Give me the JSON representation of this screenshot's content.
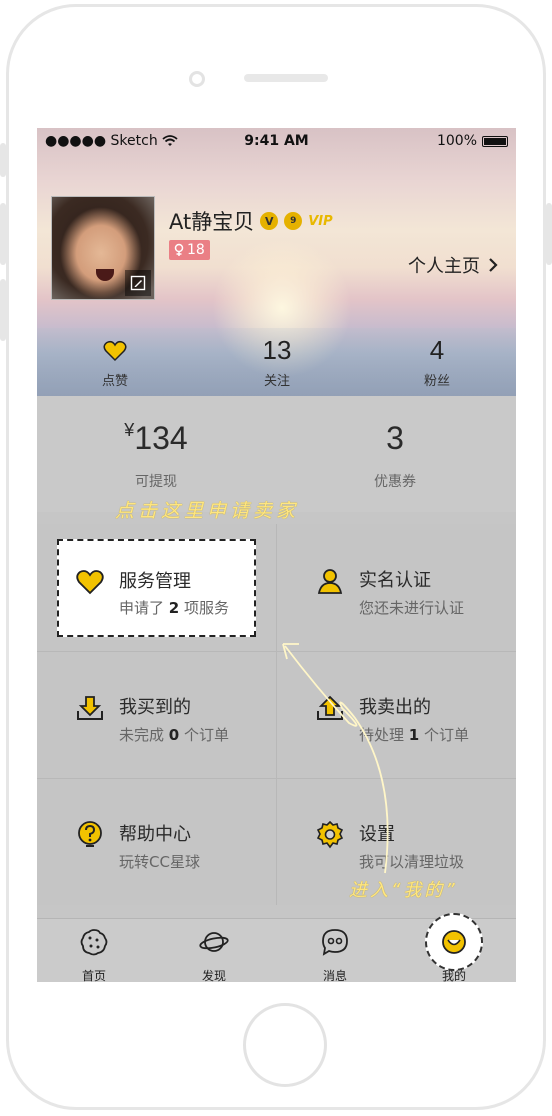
{
  "status_bar": {
    "carrier": "●●●●● Sketch",
    "time": "9:41 AM",
    "battery": "100%"
  },
  "profile": {
    "username": "At静宝贝",
    "badge_v": "V",
    "badge_level": "9",
    "badge_vip": "VIP",
    "gender_age": "18",
    "home_link": "个人主页"
  },
  "stats": [
    {
      "value": "",
      "label": "点赞"
    },
    {
      "value": "13",
      "label": "关注"
    },
    {
      "value": "4",
      "label": "粉丝"
    }
  ],
  "wallet": {
    "currency": "¥",
    "withdrawable": "134",
    "withdrawable_label": "可提现",
    "coupons": "3",
    "coupons_label": "优惠券"
  },
  "hints": {
    "apply_seller": "点击这里申请卖家",
    "enter_mine": "进入“我的”"
  },
  "menu": [
    {
      "title": "服务管理",
      "sub_pre": "申请了",
      "sub_num": "2",
      "sub_post": "项服务",
      "icon": "heart-icon"
    },
    {
      "title": "实名认证",
      "sub": "您还未进行认证",
      "icon": "person-icon"
    },
    {
      "title": "我买到的",
      "sub_pre": "未完成",
      "sub_num": "0",
      "sub_post": "个订单",
      "icon": "download-icon"
    },
    {
      "title": "我卖出的",
      "sub_pre": "待处理",
      "sub_num": "1",
      "sub_post": "个订单",
      "icon": "upload-icon"
    },
    {
      "title": "帮助中心",
      "sub": "玩转CC星球",
      "icon": "question-bulb-icon"
    },
    {
      "title": "设置",
      "sub": "我可以清理垃圾",
      "icon": "gear-icon"
    }
  ],
  "tabs": [
    {
      "label": "首页",
      "icon": "cookie-icon"
    },
    {
      "label": "发现",
      "icon": "planet-icon"
    },
    {
      "label": "消息",
      "icon": "chat-icon"
    },
    {
      "label": "我的",
      "icon": "smile-icon"
    }
  ],
  "colors": {
    "accent": "#e5b100",
    "hint": "#ffe680",
    "gender_badge": "#ea7f85"
  }
}
